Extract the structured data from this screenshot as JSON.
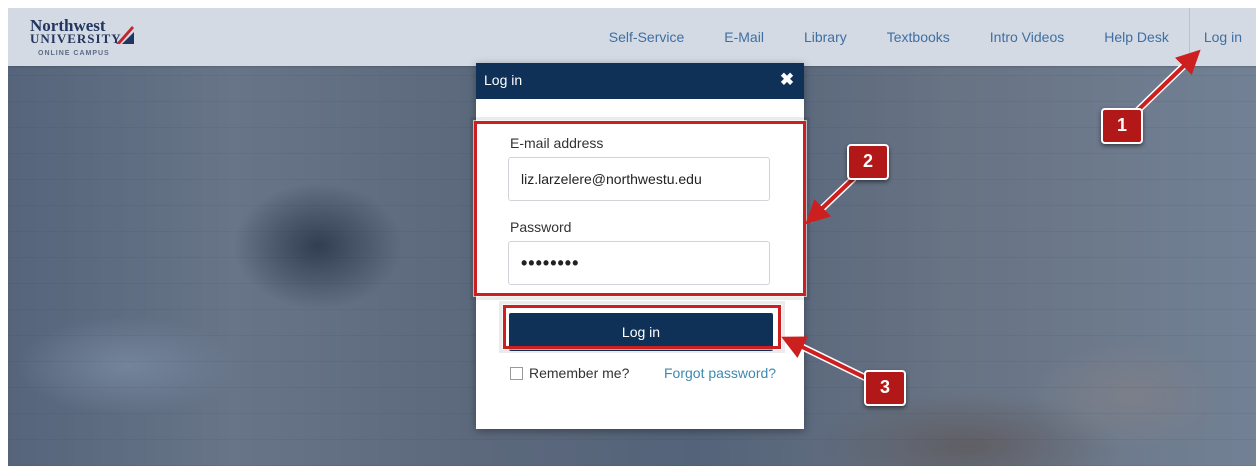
{
  "header": {
    "logo": {
      "line1": "Northwest",
      "line2": "UNIVERSITY",
      "tagline": "ONLINE CAMPUS"
    },
    "nav": [
      {
        "label": "Self-Service"
      },
      {
        "label": "E-Mail"
      },
      {
        "label": "Library"
      },
      {
        "label": "Textbooks"
      },
      {
        "label": "Intro Videos"
      },
      {
        "label": "Help Desk"
      },
      {
        "label": "Log in"
      }
    ]
  },
  "modal": {
    "title": "Log in",
    "close_icon": "close-icon",
    "email": {
      "label": "E-mail address",
      "value": "liz.larzelere@northwestu.edu"
    },
    "password": {
      "label": "Password",
      "masked_value": "••••••••"
    },
    "submit_label": "Log in",
    "remember_label": "Remember me?",
    "forgot_label": "Forgot password?"
  },
  "annotations": {
    "badges": [
      "1",
      "2",
      "3"
    ],
    "color": "#cc1f1f"
  },
  "colors": {
    "header_bg": "#d3dae3",
    "nav_link": "#3f6fa3",
    "modal_header": "#0f3158",
    "link": "#3d8ab0"
  }
}
